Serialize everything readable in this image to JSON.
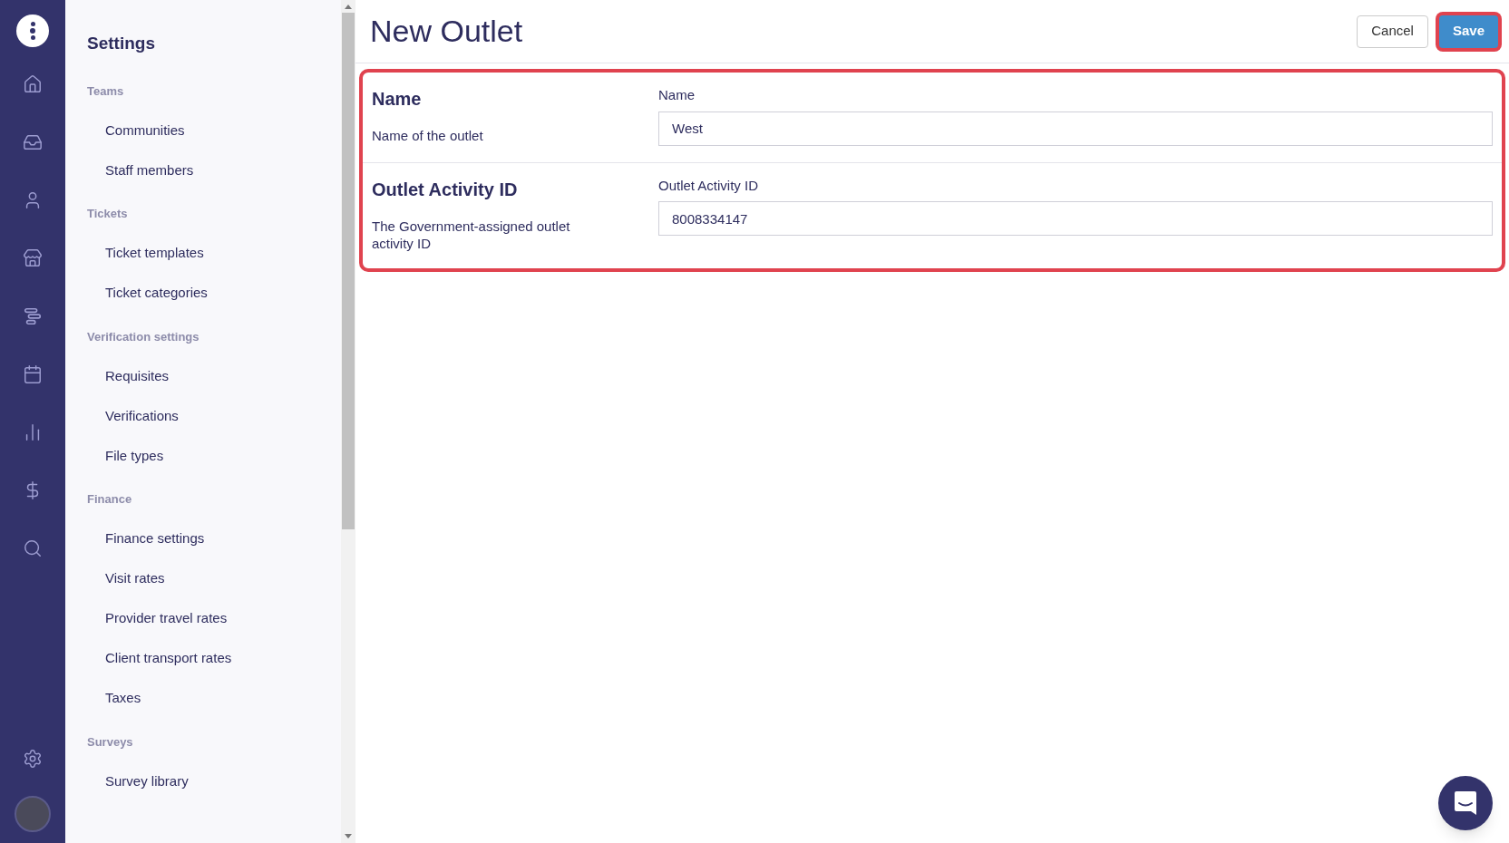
{
  "sidebar": {
    "title": "Settings",
    "sections": [
      {
        "heading": "Teams",
        "items": [
          "Communities",
          "Staff members"
        ]
      },
      {
        "heading": "Tickets",
        "items": [
          "Ticket templates",
          "Ticket categories"
        ]
      },
      {
        "heading": "Verification settings",
        "items": [
          "Requisites",
          "Verifications",
          "File types"
        ]
      },
      {
        "heading": "Finance",
        "items": [
          "Finance settings",
          "Visit rates",
          "Provider travel rates",
          "Client transport rates",
          "Taxes"
        ]
      },
      {
        "heading": "Surveys",
        "items": [
          "Survey library"
        ]
      }
    ]
  },
  "page": {
    "title": "New Outlet",
    "buttons": [
      {
        "label": "Cancel",
        "kind": "secondary",
        "highlighted": false
      },
      {
        "label": "Save",
        "kind": "primary",
        "highlighted": true
      }
    ]
  },
  "form": {
    "highlighted": true,
    "fields": [
      {
        "heading": "Name",
        "description": "Name of the outlet",
        "label": "Name",
        "value": "West"
      },
      {
        "heading": "Outlet Activity ID",
        "description": "The Government-assigned outlet activity ID",
        "label": "Outlet Activity ID",
        "value": "8008334147"
      }
    ]
  }
}
